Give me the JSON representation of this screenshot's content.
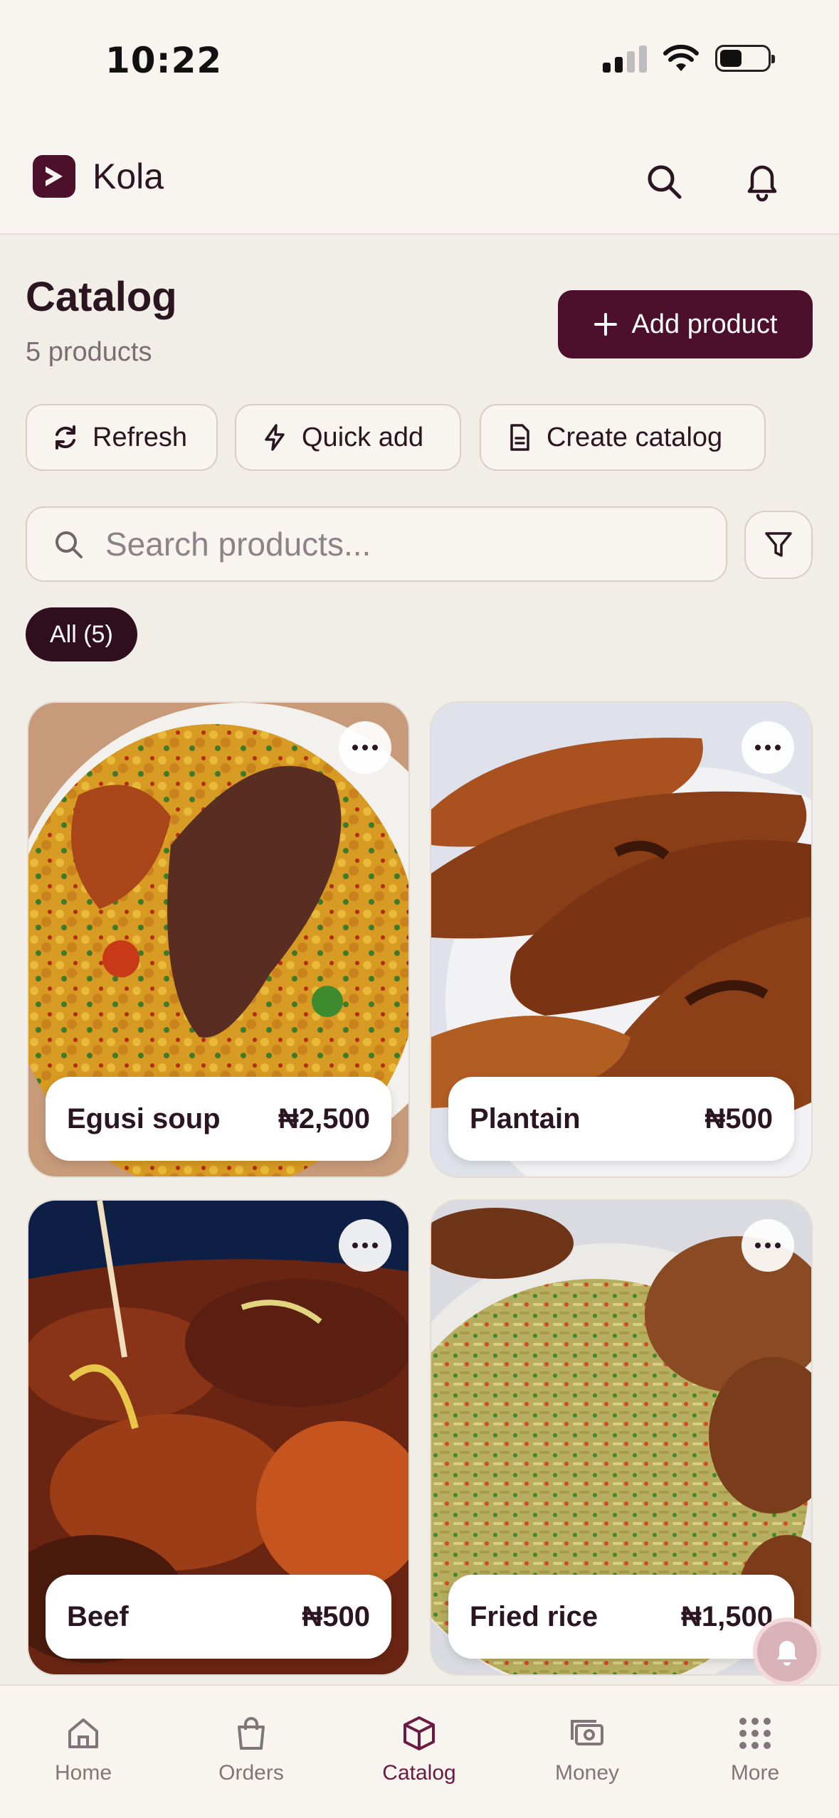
{
  "status_bar": {
    "time": "10:22"
  },
  "header": {
    "app_name": "Kola"
  },
  "catalog": {
    "title": "Catalog",
    "subtitle": "5 products",
    "add_button": "Add product",
    "actions": {
      "refresh": "Refresh",
      "quick_add": "Quick add",
      "create_catalog": "Create catalog"
    },
    "search_placeholder": "Search products...",
    "filter_chip": "All (5)"
  },
  "products": [
    {
      "name": "Egusi soup",
      "price": "₦2,500"
    },
    {
      "name": "Plantain",
      "price": "₦500"
    },
    {
      "name": "Beef",
      "price": "₦500"
    },
    {
      "name": "Fried rice",
      "price": "₦1,500"
    }
  ],
  "nav": {
    "home": "Home",
    "orders": "Orders",
    "catalog": "Catalog",
    "money": "Money",
    "more": "More"
  },
  "colors": {
    "brand": "#4c0f2c",
    "active_nav": "#6b1a42",
    "background": "#f1ede7"
  }
}
